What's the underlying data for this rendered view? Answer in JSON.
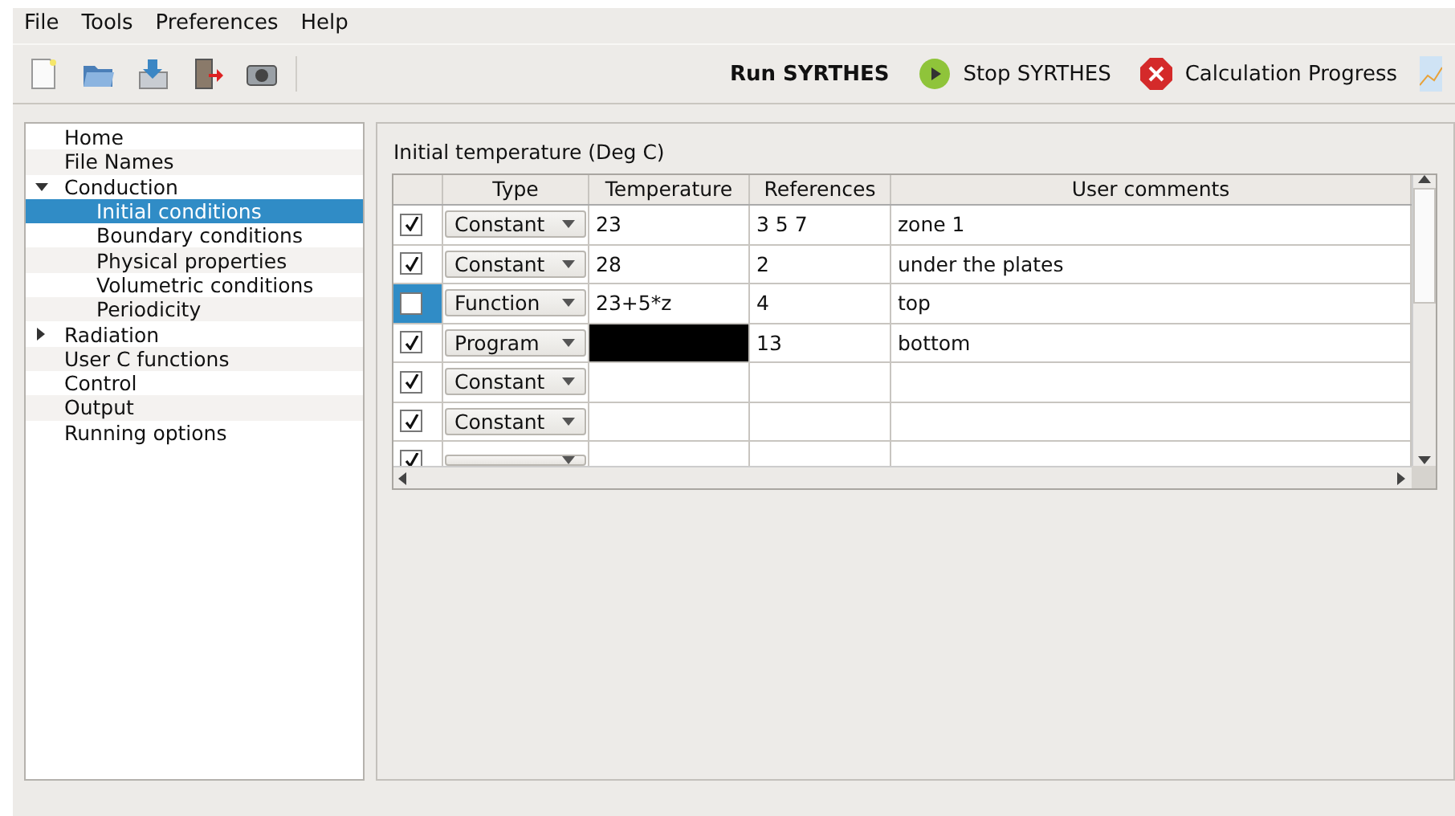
{
  "menu": [
    "File",
    "Tools",
    "Preferences",
    "Help"
  ],
  "toolbar": {
    "run": "Run SYRTHES",
    "stop": "Stop SYRTHES",
    "progress": "Calculation Progress"
  },
  "tree": [
    {
      "label": "Home",
      "selected": false
    },
    {
      "label": "File Names",
      "selected": false
    },
    {
      "label": "Conduction",
      "selected": false,
      "expanded": true,
      "children": [
        {
          "label": "Initial conditions",
          "selected": true
        },
        {
          "label": "Boundary conditions",
          "selected": false
        },
        {
          "label": "Physical properties",
          "selected": false
        },
        {
          "label": "Volumetric conditions",
          "selected": false
        },
        {
          "label": "Periodicity",
          "selected": false
        }
      ]
    },
    {
      "label": "Radiation",
      "selected": false,
      "expanded": false
    },
    {
      "label": "User C functions",
      "selected": false
    },
    {
      "label": "Control",
      "selected": false
    },
    {
      "label": "Output",
      "selected": false
    },
    {
      "label": "Running options",
      "selected": false
    }
  ],
  "panel": {
    "title": "Initial temperature (Deg C)",
    "table": {
      "columns": [
        "Type",
        "Temperature",
        "References",
        "User comments"
      ],
      "rows": [
        {
          "checked": true,
          "selected": false,
          "type": "Constant",
          "temperature": "23",
          "temperature_enabled": true,
          "references": "3 5 7",
          "comments": "zone 1"
        },
        {
          "checked": true,
          "selected": false,
          "type": "Constant",
          "temperature": "28",
          "temperature_enabled": true,
          "references": "2",
          "comments": "under the plates"
        },
        {
          "checked": false,
          "selected": true,
          "type": "Function",
          "temperature": "23+5*z",
          "temperature_enabled": true,
          "references": "4",
          "comments": "top"
        },
        {
          "checked": true,
          "selected": false,
          "type": "Program",
          "temperature_enabled": false,
          "references": "13",
          "comments": "bottom"
        },
        {
          "checked": true,
          "selected": false,
          "type": "Constant",
          "temperature_enabled": true
        },
        {
          "checked": true,
          "selected": false,
          "type": "Constant",
          "temperature_enabled": true
        },
        {
          "checked": true,
          "selected": false,
          "temperature_enabled": true
        }
      ]
    }
  }
}
